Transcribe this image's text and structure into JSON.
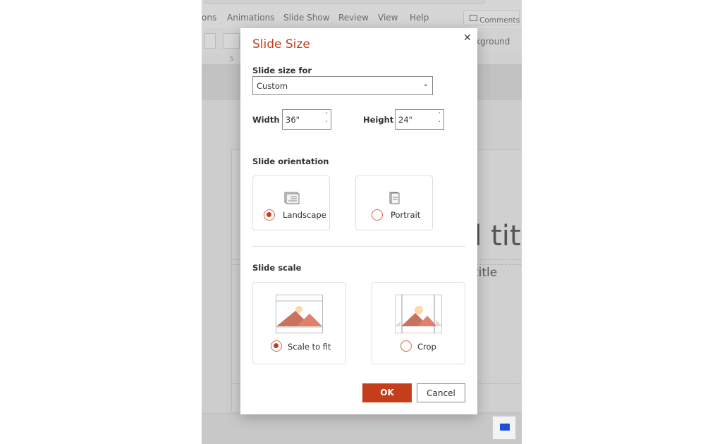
{
  "app": {
    "menu": [
      "ons",
      "Animations",
      "Slide Show",
      "Review",
      "View",
      "Help"
    ],
    "comments_label": "Comments",
    "ribbon_background_label": "kground",
    "ruler_mark": "5",
    "slide_title_fragment": "d tit",
    "slide_subtitle_fragment": "title"
  },
  "dialog": {
    "title": "Slide Size",
    "size_for_label": "Slide size for",
    "size_for_value": "Custom",
    "width_label": "Width",
    "width_value": "36\"",
    "height_label": "Height",
    "height_value": "24\"",
    "orientation_label": "Slide orientation",
    "orientation_options": [
      {
        "label": "Landscape",
        "selected": true
      },
      {
        "label": "Portrait",
        "selected": false
      }
    ],
    "scale_label": "Slide scale",
    "scale_options": [
      {
        "label": "Scale to fit",
        "selected": true
      },
      {
        "label": "Crop",
        "selected": false
      }
    ],
    "ok_label": "OK",
    "cancel_label": "Cancel"
  },
  "colors": {
    "accent": "#c43e1c",
    "present_icon": "#1f4fd8"
  }
}
